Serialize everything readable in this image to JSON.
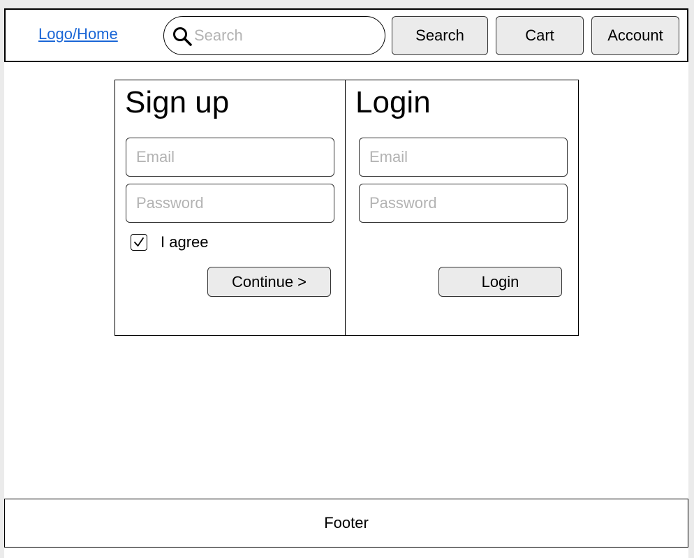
{
  "header": {
    "logo_label": "Logo/Home",
    "search": {
      "placeholder": "Search",
      "value": "",
      "icon": "search-icon"
    },
    "search_button_label": "Search",
    "cart_button_label": "Cart",
    "account_button_label": "Account"
  },
  "signup": {
    "title": "Sign up",
    "email_placeholder": "Email",
    "password_placeholder": "Password",
    "agree_checked": true,
    "agree_label": "I agree",
    "continue_label": "Continue >"
  },
  "login": {
    "title": "Login",
    "email_placeholder": "Email",
    "password_placeholder": "Password",
    "login_label": "Login"
  },
  "footer": {
    "label": "Footer"
  },
  "colors": {
    "link": "#1a66d6",
    "button_bg": "#ebebeb",
    "placeholder": "#b3b3b3",
    "page_bg": "#ebebeb"
  }
}
